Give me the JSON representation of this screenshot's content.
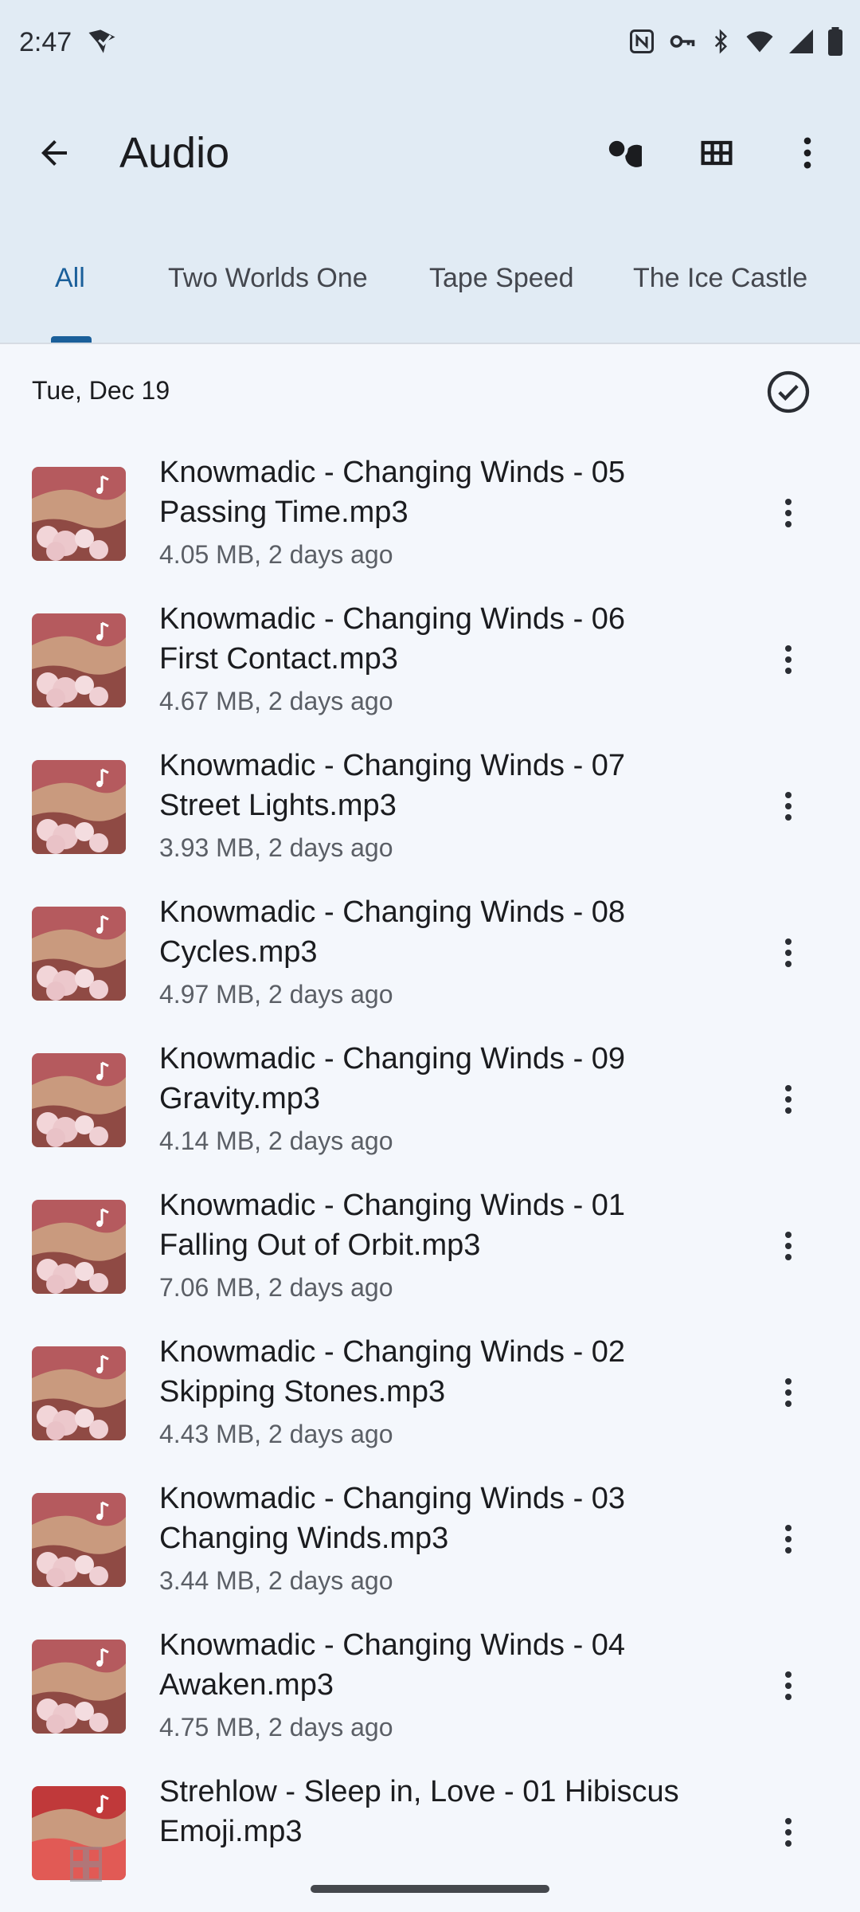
{
  "status": {
    "time": "2:47"
  },
  "appbar": {
    "title": "Audio",
    "icons": [
      "back-arrow-icon",
      "search-icon",
      "grid-view-icon",
      "more-vert-icon"
    ]
  },
  "tabs": [
    {
      "label": "All",
      "active": true
    },
    {
      "label": "Two Worlds One",
      "active": false
    },
    {
      "label": "Tape Speed",
      "active": false
    },
    {
      "label": "The Ice Castle",
      "active": false
    }
  ],
  "section": {
    "date": "Tue, Dec 19"
  },
  "files": [
    {
      "line1": "Knowmadic - Changing Winds - 05",
      "line2": "Passing Time.mp3",
      "meta": "4.05 MB, 2 days ago"
    },
    {
      "line1": "Knowmadic - Changing Winds - 06",
      "line2": "First Contact.mp3",
      "meta": "4.67 MB, 2 days ago"
    },
    {
      "line1": "Knowmadic - Changing Winds - 07",
      "line2": "Street Lights.mp3",
      "meta": "3.93 MB, 2 days ago"
    },
    {
      "line1": "Knowmadic - Changing Winds - 08",
      "line2": "Cycles.mp3",
      "meta": "4.97 MB, 2 days ago"
    },
    {
      "line1": "Knowmadic - Changing Winds - 09",
      "line2": "Gravity.mp3",
      "meta": "4.14 MB, 2 days ago"
    },
    {
      "line1": "Knowmadic - Changing Winds - 01",
      "line2": "Falling Out of Orbit.mp3",
      "meta": "7.06 MB, 2 days ago"
    },
    {
      "line1": "Knowmadic - Changing Winds - 02",
      "line2": "Skipping Stones.mp3",
      "meta": "4.43 MB, 2 days ago"
    },
    {
      "line1": "Knowmadic - Changing Winds - 03",
      "line2": "Changing Winds.mp3",
      "meta": "3.44 MB, 2 days ago"
    },
    {
      "line1": "Knowmadic - Changing Winds - 04",
      "line2": "Awaken.mp3",
      "meta": "4.75 MB, 2 days ago"
    },
    {
      "line1": "Strehlow - Sleep in, Love - 01 Hibiscus",
      "line2": "Emoji.mp3",
      "meta": ""
    }
  ],
  "colors": {
    "topbar_bg": "#e1ebf4",
    "page_bg": "#f4f7fc",
    "accent": "#1a5f9a"
  }
}
